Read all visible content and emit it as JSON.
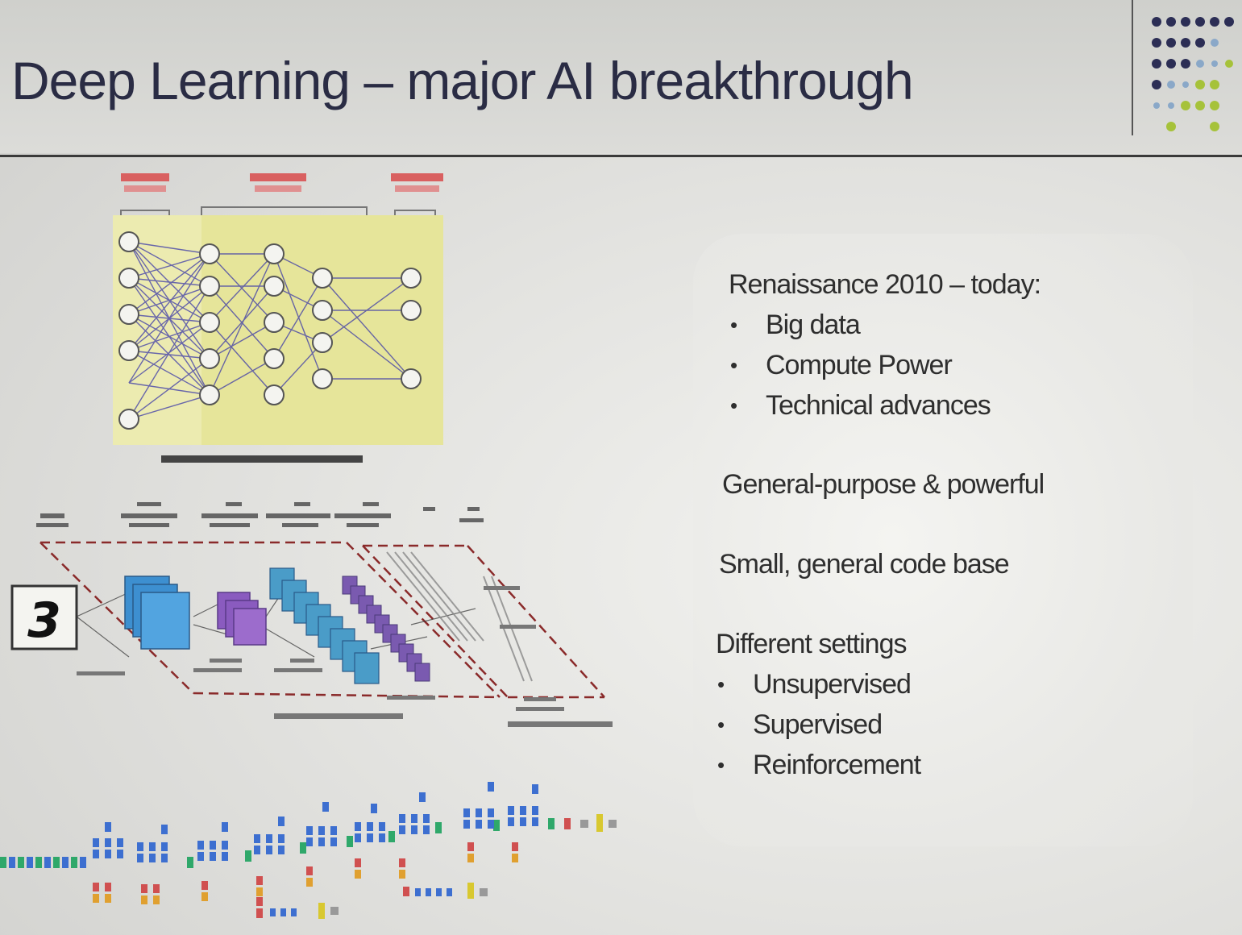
{
  "slide": {
    "title": "Deep Learning – major AI breakthrough"
  },
  "content": {
    "renaissance": {
      "heading": "Renaissance 2010 – today:",
      "items": [
        "Big data",
        "Compute Power",
        "Technical advances"
      ]
    },
    "general_purpose": "General-purpose & powerful",
    "code_base": "Small, general code base",
    "settings": {
      "heading": "Different settings",
      "items": [
        "Unsupervised",
        "Supervised",
        "Reinforcement"
      ]
    }
  },
  "figures": {
    "cnn_input_digit": "3"
  },
  "colors": {
    "title_text": "#2a2c44",
    "highlight_yellow": "#e8e89a",
    "network_edges": "#3c3aa8",
    "cnn_blue": "#3d8fd0",
    "cnn_purple": "#8a5bbf",
    "dashed_frame": "#8a2a2a"
  }
}
